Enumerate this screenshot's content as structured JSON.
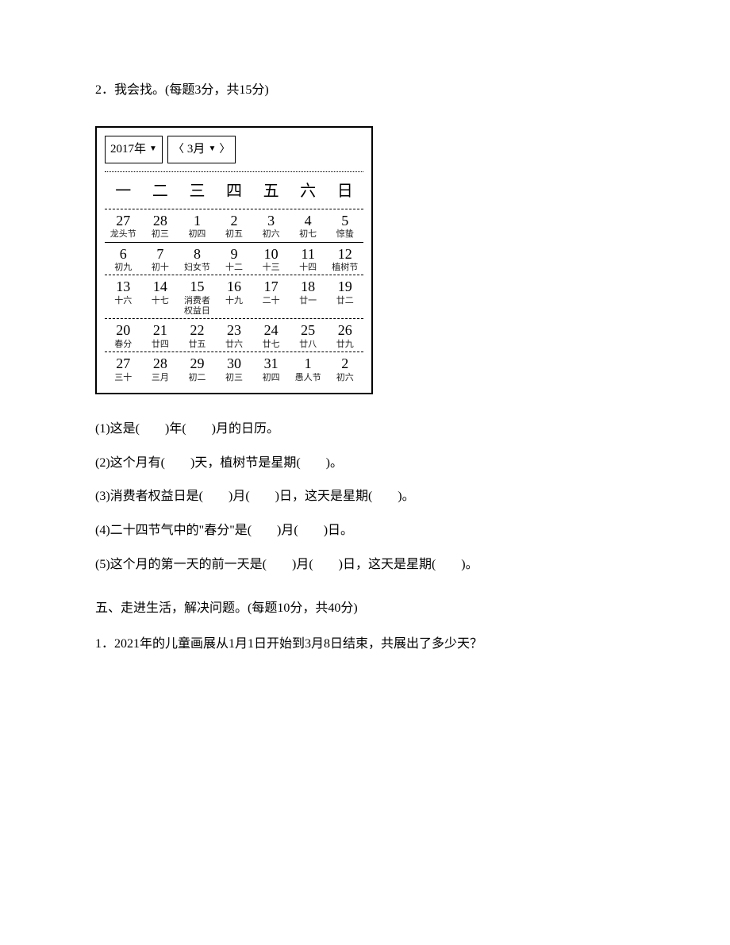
{
  "q2": {
    "title": "2．我会找。(每题3分，共15分)",
    "calendar": {
      "year_label": "2017年",
      "month_label": "3月",
      "weekdays": [
        "一",
        "二",
        "三",
        "四",
        "五",
        "六",
        "日"
      ],
      "rows": [
        [
          {
            "num": "27",
            "lunar": "龙头节"
          },
          {
            "num": "28",
            "lunar": "初三"
          },
          {
            "num": "1",
            "lunar": "初四"
          },
          {
            "num": "2",
            "lunar": "初五"
          },
          {
            "num": "3",
            "lunar": "初六"
          },
          {
            "num": "4",
            "lunar": "初七"
          },
          {
            "num": "5",
            "lunar": "惊蛰"
          }
        ],
        [
          {
            "num": "6",
            "lunar": "初九"
          },
          {
            "num": "7",
            "lunar": "初十"
          },
          {
            "num": "8",
            "lunar": "妇女节"
          },
          {
            "num": "9",
            "lunar": "十二"
          },
          {
            "num": "10",
            "lunar": "十三"
          },
          {
            "num": "11",
            "lunar": "十四"
          },
          {
            "num": "12",
            "lunar": "植树节"
          }
        ],
        [
          {
            "num": "13",
            "lunar": "十六"
          },
          {
            "num": "14",
            "lunar": "十七"
          },
          {
            "num": "15",
            "lunar": "消费者\n权益日"
          },
          {
            "num": "16",
            "lunar": "十九"
          },
          {
            "num": "17",
            "lunar": "二十"
          },
          {
            "num": "18",
            "lunar": "廿一"
          },
          {
            "num": "19",
            "lunar": "廿二"
          }
        ],
        [
          {
            "num": "20",
            "lunar": "春分"
          },
          {
            "num": "21",
            "lunar": "廿四"
          },
          {
            "num": "22",
            "lunar": "廿五"
          },
          {
            "num": "23",
            "lunar": "廿六"
          },
          {
            "num": "24",
            "lunar": "廿七"
          },
          {
            "num": "25",
            "lunar": "廿八"
          },
          {
            "num": "26",
            "lunar": "廿九"
          }
        ],
        [
          {
            "num": "27",
            "lunar": "三十"
          },
          {
            "num": "28",
            "lunar": "三月"
          },
          {
            "num": "29",
            "lunar": "初二"
          },
          {
            "num": "30",
            "lunar": "初三"
          },
          {
            "num": "31",
            "lunar": "初四"
          },
          {
            "num": "1",
            "lunar": "愚人节"
          },
          {
            "num": "2",
            "lunar": "初六"
          }
        ]
      ]
    },
    "items": {
      "i1": "(1)这是(　　)年(　　)月的日历。",
      "i2": "(2)这个月有(　　)天，植树节是星期(　　)。",
      "i3": "(3)消费者权益日是(　　)月(　　)日，这天是星期(　　)。",
      "i4": "(4)二十四节气中的\"春分\"是(　　)月(　　)日。",
      "i5": "(5)这个月的第一天的前一天是(　　)月(　　)日，这天是星期(　　)。"
    }
  },
  "section5": {
    "title": "五、走进生活，解决问题。(每题10分，共40分)",
    "q1": "1．2021年的儿童画展从1月1日开始到3月8日结束，共展出了多少天？"
  }
}
